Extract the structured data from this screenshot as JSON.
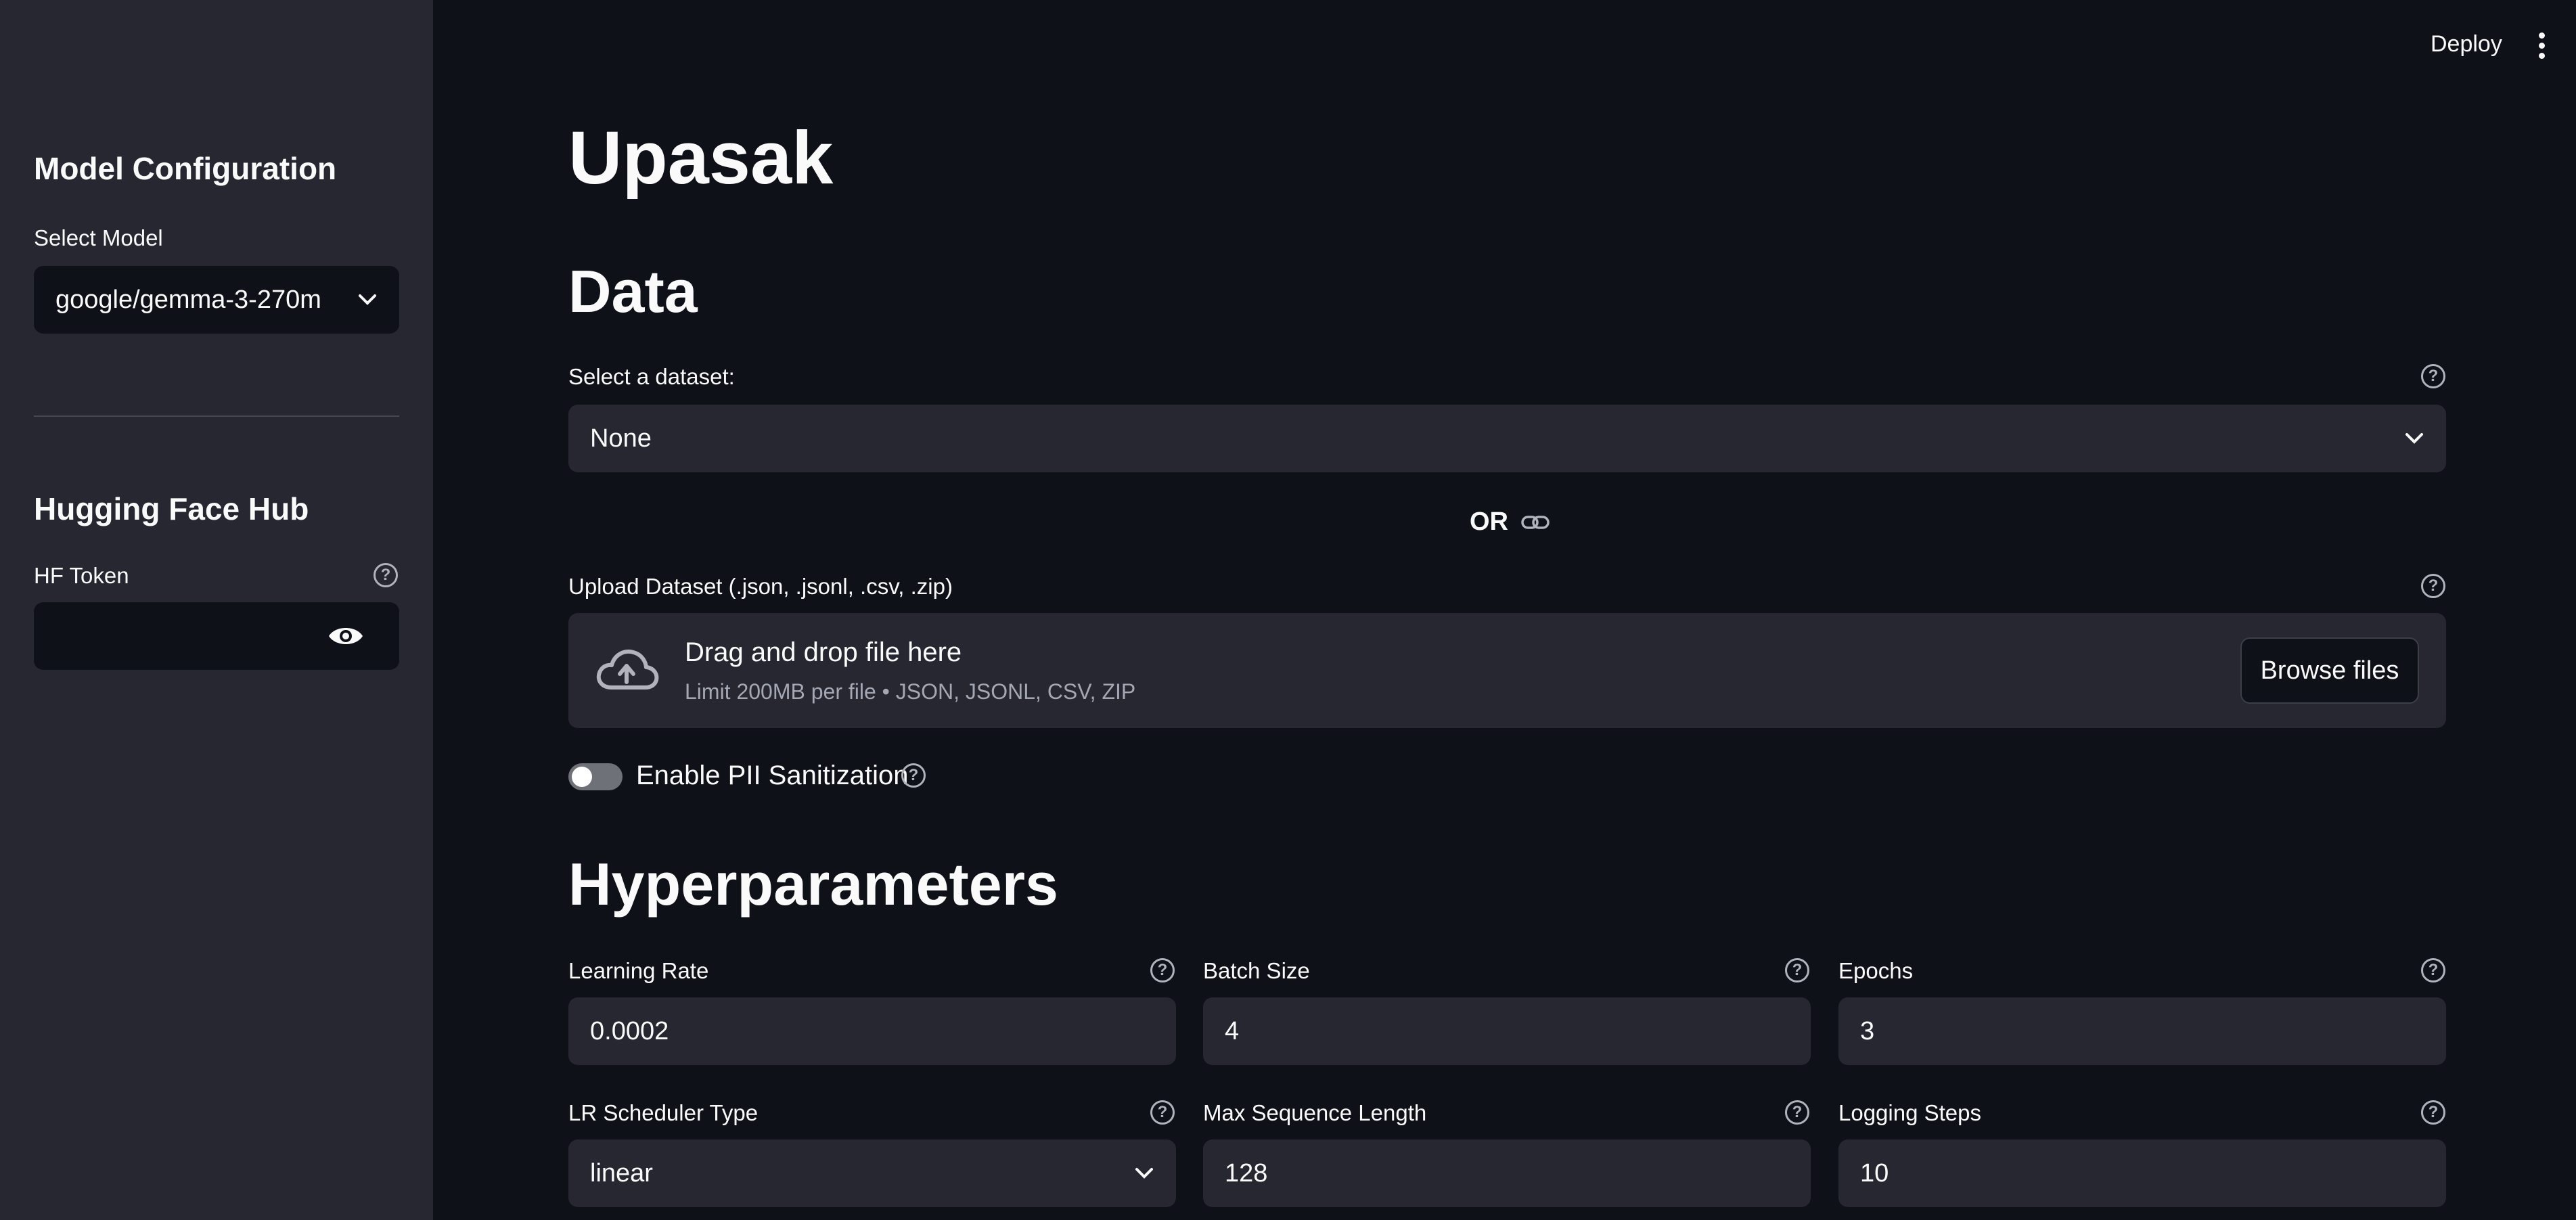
{
  "topbar": {
    "deploy_label": "Deploy"
  },
  "sidebar": {
    "model_heading": "Model Configuration",
    "select_model_label": "Select Model",
    "select_model_value": "google/gemma-3-270m",
    "hub_heading": "Hugging Face Hub",
    "hf_token_label": "HF Token",
    "hf_token_value": ""
  },
  "main": {
    "title": "Upasak",
    "data_heading": "Data",
    "dataset_label": "Select a dataset:",
    "dataset_value": "None",
    "or_text": "OR",
    "upload_label": "Upload Dataset (.json, .jsonl, .csv, .zip)",
    "upload_main": "Drag and drop file here",
    "upload_sub": "Limit 200MB per file • JSON, JSONL, CSV, ZIP",
    "browse_label": "Browse files",
    "pii_label": "Enable PII Sanitization",
    "pii_enabled": false,
    "hyper_heading": "Hyperparameters",
    "learning_rate_label": "Learning Rate",
    "learning_rate_value": "0.0002",
    "batch_size_label": "Batch Size",
    "batch_size_value": "4",
    "epochs_label": "Epochs",
    "epochs_value": "3",
    "scheduler_label": "LR Scheduler Type",
    "scheduler_value": "linear",
    "max_seq_label": "Max Sequence Length",
    "max_seq_value": "128",
    "logging_steps_label": "Logging Steps",
    "logging_steps_value": "10"
  },
  "help_glyph": "?",
  "colors": {
    "background": "#0e1117",
    "sidebar": "#262730",
    "input": "#262730",
    "text": "#fafafa"
  }
}
